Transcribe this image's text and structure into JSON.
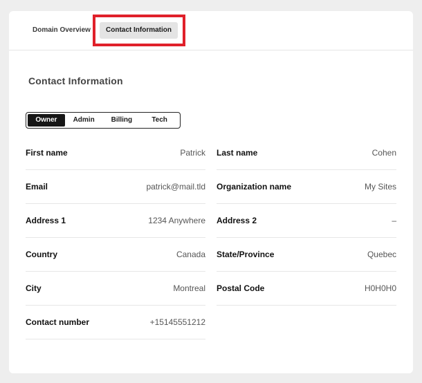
{
  "tabs": [
    {
      "label": "Domain Overview"
    },
    {
      "label": "Contact Information"
    }
  ],
  "section_title": "Contact Information",
  "contact_types": [
    "Owner",
    "Admin",
    "Billing",
    "Tech"
  ],
  "selected_contact_type": "Owner",
  "fields_left": [
    {
      "label": "First name",
      "value": "Patrick"
    },
    {
      "label": "Email",
      "value": "patrick@mail.tld"
    },
    {
      "label": "Address 1",
      "value": "1234 Anywhere"
    },
    {
      "label": "Country",
      "value": "Canada"
    },
    {
      "label": "City",
      "value": "Montreal"
    },
    {
      "label": "Contact number",
      "value": "+15145551212"
    }
  ],
  "fields_right": [
    {
      "label": "Last name",
      "value": "Cohen"
    },
    {
      "label": "Organization name",
      "value": "My Sites"
    },
    {
      "label": "Address 2",
      "value": "–"
    },
    {
      "label": "State/Province",
      "value": "Quebec"
    },
    {
      "label": "Postal Code",
      "value": "H0H0H0"
    }
  ],
  "colors": {
    "highlight": "#e0202a",
    "active_segment": "#161616",
    "active_tab_bg": "#e4e4e4"
  }
}
